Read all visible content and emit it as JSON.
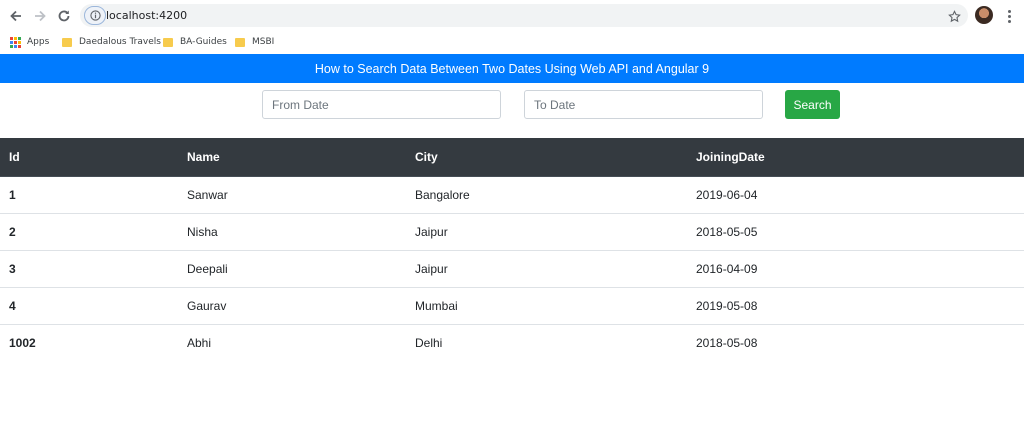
{
  "browser": {
    "url": "localhost:4200",
    "bookmarks": [
      {
        "label": "Apps",
        "icon": "apps-grid-icon"
      },
      {
        "label": "Daedalous Travels",
        "icon": "folder-icon"
      },
      {
        "label": "BA-Guides",
        "icon": "folder-icon"
      },
      {
        "label": "MSBI",
        "icon": "folder-icon"
      }
    ]
  },
  "app": {
    "title": "How to Search Data Between Two Dates Using Web API and Angular 9",
    "accent_color": "#007bff"
  },
  "search": {
    "from_placeholder": "From Date",
    "to_placeholder": "To Date",
    "button_label": "Search",
    "button_color": "#28a745"
  },
  "table": {
    "headers": [
      "Id",
      "Name",
      "City",
      "JoiningDate"
    ],
    "rows": [
      [
        "1",
        "Sanwar",
        "Bangalore",
        "2019-06-04"
      ],
      [
        "2",
        "Nisha",
        "Jaipur",
        "2018-05-05"
      ],
      [
        "3",
        "Deepali",
        "Jaipur",
        "2016-04-09"
      ],
      [
        "4",
        "Gaurav",
        "Mumbai",
        "2019-05-08"
      ],
      [
        "1002",
        "Abhi",
        "Delhi",
        "2018-05-08"
      ]
    ]
  }
}
